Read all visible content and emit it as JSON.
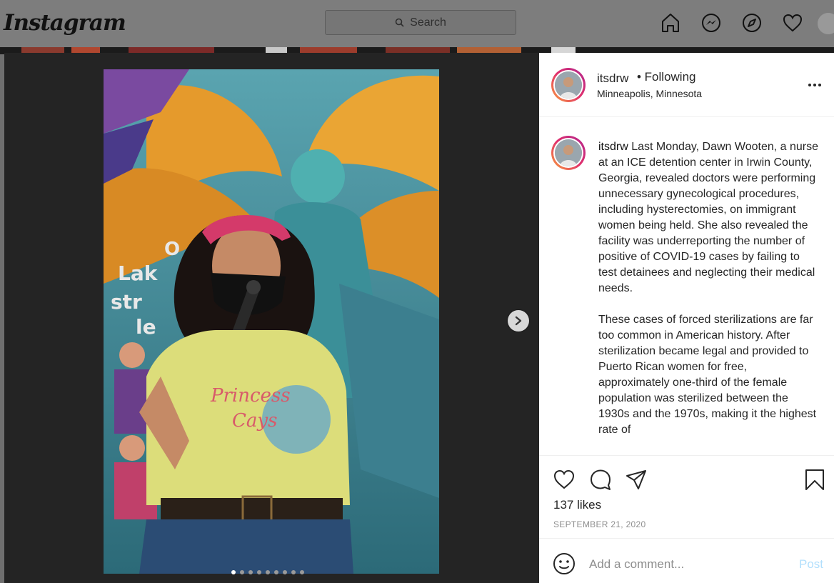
{
  "nav": {
    "logo": "Instagram",
    "search_placeholder": "Search",
    "icons": [
      "home-icon",
      "messenger-icon",
      "explore-icon",
      "heart-icon",
      "profile-avatar"
    ]
  },
  "post": {
    "username": "itsdrw",
    "follow_status": "• Following",
    "location": "Minneapolis, Minnesota",
    "caption_paragraphs": [
      "Last Monday, Dawn Wooten, a nurse at an ICE detention center in Irwin County, Georgia, revealed doctors were performing unnecessary gynecological procedures, including hysterectomies, on immigrant women being held. She also revealed the facility was underreporting the number of positive of COVID-19 cases by failing to test detainees and neglecting their medical needs.",
      "These cases of forced sterilizations are far too common in American history. After sterilization became legal and provided to Puerto Rican women for free, approximately one-third of the female population was sterilized between the 1930s and the 1970s, making it the highest rate of"
    ],
    "likes": "137 likes",
    "date": "SEPTEMBER 21, 2020",
    "comment_placeholder": "Add a comment...",
    "post_button": "Post",
    "carousel": {
      "total": 9,
      "active": 0
    }
  },
  "colors": {
    "accent": "#0095f6",
    "post_disabled": "#b2dffc",
    "ring_start": "#f9a13b",
    "ring_end": "#b0268f"
  }
}
